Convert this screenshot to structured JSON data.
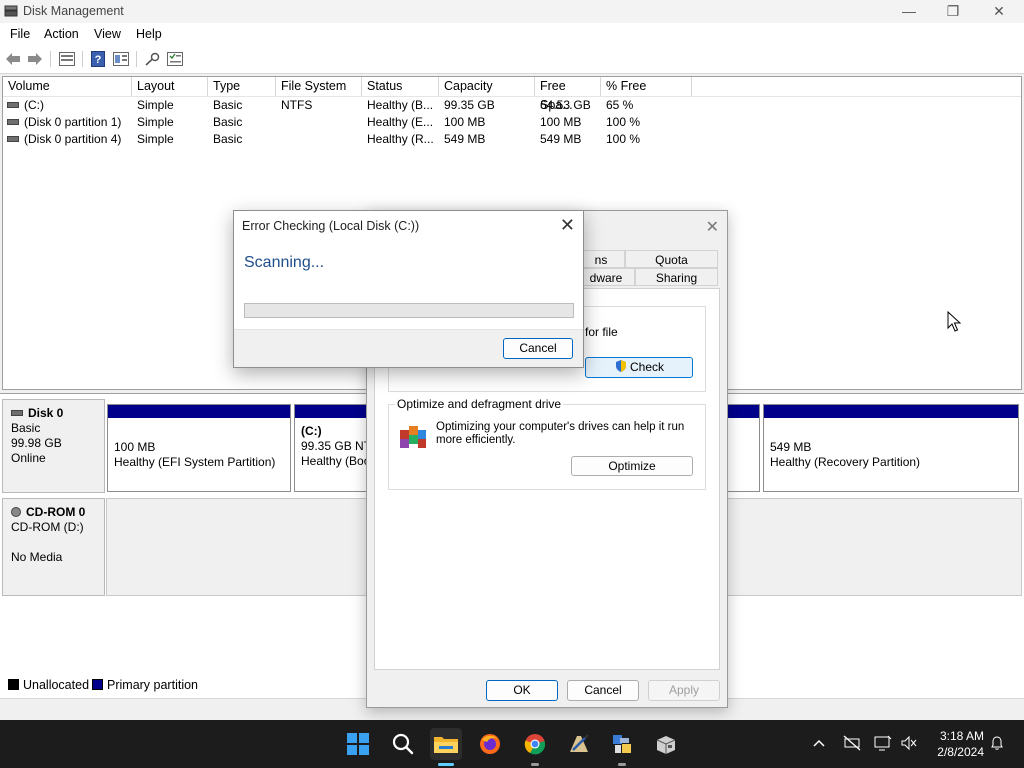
{
  "window": {
    "title": "Disk Management",
    "minimize": "—",
    "maximize": "❐",
    "close": "✕"
  },
  "menu": [
    "File",
    "Action",
    "View",
    "Help"
  ],
  "toolbar_icons": [
    "back-arrow-icon",
    "forward-arrow-icon",
    "disk-list-icon",
    "help-icon",
    "properties-icon",
    "key-icon",
    "settings-list-icon"
  ],
  "volumes": {
    "headers": [
      "Volume",
      "Layout",
      "Type",
      "File System",
      "Status",
      "Capacity",
      "Free Spa...",
      "% Free"
    ],
    "rows": [
      [
        "(C:)",
        "Simple",
        "Basic",
        "NTFS",
        "Healthy (B...",
        "99.35 GB",
        "64.53 GB",
        "65 %"
      ],
      [
        "(Disk 0 partition 1)",
        "Simple",
        "Basic",
        "",
        "Healthy (E...",
        "100 MB",
        "100 MB",
        "100 %"
      ],
      [
        "(Disk 0 partition 4)",
        "Simple",
        "Basic",
        "",
        "Healthy (R...",
        "549 MB",
        "549 MB",
        "100 %"
      ]
    ]
  },
  "disks": {
    "disk0": {
      "name": "Disk 0",
      "type": "Basic",
      "size": "99.98 GB",
      "state": "Online",
      "partitions": [
        {
          "size": "100 MB",
          "status": "Healthy (EFI System Partition)"
        },
        {
          "name": "(C:)",
          "size": "99.35 GB NTI",
          "status": "Healthy (Boo"
        },
        {
          "size": "549 MB",
          "status": "Healthy (Recovery Partition)"
        }
      ]
    },
    "cdrom0": {
      "name": "CD-ROM 0",
      "drive": "CD-ROM (D:)",
      "media": "No Media"
    }
  },
  "legend": {
    "unallocated": "Unallocated",
    "primary": "Primary partition",
    "unallocated_color": "#000000",
    "primary_color": "#00008b"
  },
  "properties_dialog": {
    "close": "✕",
    "tabs": [
      "ns",
      "Quota",
      "dware",
      "Sharing"
    ],
    "error_checking_text": "for file",
    "check_button": "Check",
    "optimize_group_title": "Optimize and defragment drive",
    "optimize_text": "Optimizing your computer's drives can help it run more efficiently.",
    "optimize_button": "Optimize",
    "ok_button": "OK",
    "cancel_button": "Cancel",
    "apply_button": "Apply"
  },
  "error_dialog": {
    "title": "Error Checking (Local Disk (C:))",
    "close": "✕",
    "status": "Scanning...",
    "progress": 0,
    "cancel_button": "Cancel"
  },
  "taskbar": {
    "apps": [
      "start-icon",
      "search-icon",
      "file-explorer-icon",
      "firefox-icon",
      "chrome-icon",
      "drawing-tool-icon",
      "network-app-icon",
      "package-icon"
    ],
    "time": "3:18 AM",
    "date": "2/8/2024",
    "accent": "#60cdff"
  }
}
